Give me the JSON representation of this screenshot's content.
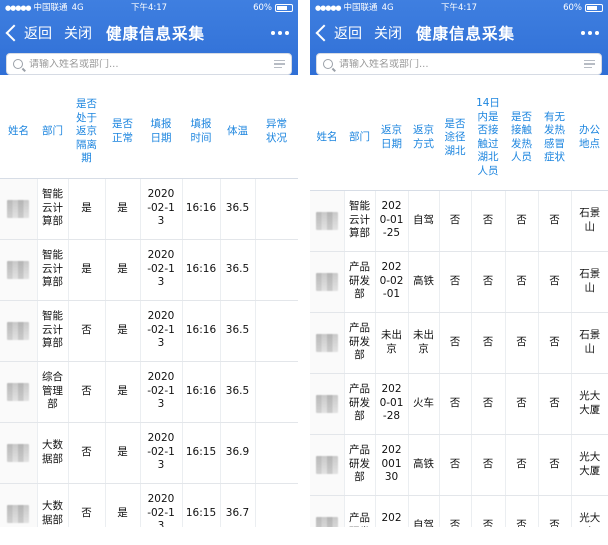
{
  "status_bar": {
    "carrier": "中国联通",
    "network": "4G",
    "time": "下午4:17",
    "battery": "60%"
  },
  "nav": {
    "back_label": "返回",
    "close_label": "关闭",
    "title": "健康信息采集"
  },
  "search": {
    "placeholder": "请输入姓名或部门..."
  },
  "left_table": {
    "headers": [
      "姓名",
      "部门",
      "是否\n处于\n返京\n隔离\n期",
      "是否\n正常",
      "填报\n日期",
      "填报\n时间",
      "体温",
      "异常\n状况"
    ],
    "rows": [
      [
        "",
        "智能\n云计\n算部",
        "是",
        "是",
        "2020\n-02-1\n3",
        "16:16",
        "36.5",
        ""
      ],
      [
        "",
        "智能\n云计\n算部",
        "是",
        "是",
        "2020\n-02-1\n3",
        "16:16",
        "36.5",
        ""
      ],
      [
        "",
        "智能\n云计\n算部",
        "否",
        "是",
        "2020\n-02-1\n3",
        "16:16",
        "36.5",
        ""
      ],
      [
        "",
        "综合\n管理\n部",
        "否",
        "是",
        "2020\n-02-1\n3",
        "16:16",
        "36.5",
        ""
      ],
      [
        "",
        "大数\n据部",
        "否",
        "是",
        "2020\n-02-1\n3",
        "16:15",
        "36.9",
        ""
      ],
      [
        "",
        "大数\n据部",
        "否",
        "是",
        "2020\n-02-1\n3",
        "16:15",
        "36.7",
        ""
      ]
    ]
  },
  "right_table": {
    "headers": [
      "姓名",
      "部门",
      "返京\n日期",
      "返京\n方式",
      "是否\n途径\n湖北",
      "14日\n内是\n否接\n触过\n湖北\n人员",
      "是否\n接触\n发热\n人员",
      "有无\n发热\n感冒\n症状",
      "办公\n地点"
    ],
    "rows": [
      [
        "",
        "智能\n云计\n算部",
        "202\n0-01\n-25",
        "自驾",
        "否",
        "否",
        "否",
        "否",
        "石景\n山"
      ],
      [
        "",
        "产品\n研发\n部",
        "202\n0-02\n-01",
        "高铁",
        "否",
        "否",
        "否",
        "否",
        "石景\n山"
      ],
      [
        "",
        "产品\n研发\n部",
        "未出\n京",
        "未出\n京",
        "否",
        "否",
        "否",
        "否",
        "石景\n山"
      ],
      [
        "",
        "产品\n研发\n部",
        "202\n0-01\n-28",
        "火车",
        "否",
        "否",
        "否",
        "否",
        "光大\n大厦"
      ],
      [
        "",
        "产品\n研发\n部",
        "202\n001\n30",
        "高铁",
        "否",
        "否",
        "否",
        "否",
        "光大\n大厦"
      ],
      [
        "",
        "产品\n研发",
        "202\n0-01",
        "自驾",
        "否",
        "否",
        "否",
        "否",
        "光大\n大"
      ]
    ]
  },
  "icons": {
    "back": "chevron-left-icon",
    "more": "more-dots-icon",
    "search": "search-icon",
    "filter": "menu-lines-icon"
  },
  "colors": {
    "nav_bg": "#3577dc",
    "header_text": "#1c85df"
  }
}
